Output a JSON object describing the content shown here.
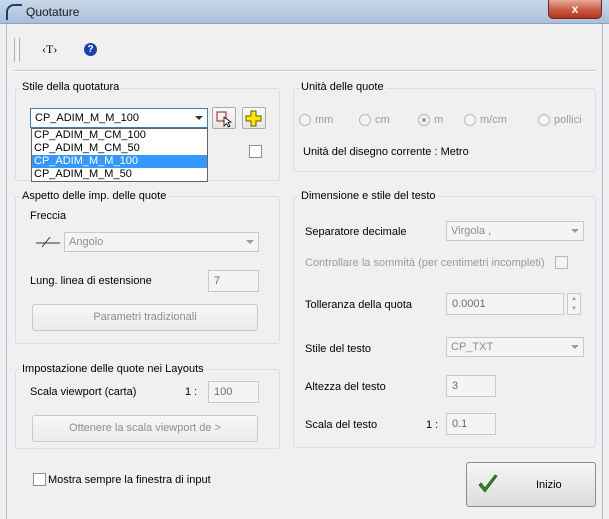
{
  "window": {
    "title": "Quotature",
    "close_label": "x"
  },
  "toolbar": {
    "text_button": "‹T›",
    "help_glyph": "?"
  },
  "stile": {
    "group_title": "Stile della quotatura",
    "selected": "CP_ADIM_M_M_100",
    "options": [
      "CP_ADIM_M_CM_100",
      "CP_ADIM_M_CM_50",
      "CP_ADIM_M_M_100",
      "CP_ADIM_M_M_50"
    ],
    "selected_index": 2
  },
  "unita": {
    "group_title": "Unità delle quote",
    "options": [
      "mm",
      "cm",
      "m",
      "m/cm",
      "pollici"
    ],
    "selected": "m",
    "corrente_label": "Unità del disegno corrente : Metro"
  },
  "aspetto": {
    "group_title": "Aspetto delle imp. delle quote",
    "freccia_label": "Freccia",
    "freccia_value": "Angolo",
    "lung_label": "Lung. linea di estensione",
    "lung_value": "7",
    "parametri_button": "Parametri tradizionali"
  },
  "layouts": {
    "group_title": "Impostazione delle quote nei Layouts",
    "scala_label": "Scala viewport (carta)",
    "scala_prefix": "1 :",
    "scala_value": "100",
    "ottenere_button": "Ottenere la scala viewport de >"
  },
  "dimensione": {
    "group_title": "Dimensione e stile del testo",
    "separatore_label": "Separatore decimale",
    "separatore_value": "Virgola ,",
    "controllare_label": "Controllare la sommità (per centimetri incompleti)",
    "tolleranza_label": "Tolleranza della quota",
    "tolleranza_value": "0.0001",
    "stile_label": "Stile del testo",
    "stile_value": "CP_TXT",
    "altezza_label": "Altezza del testo",
    "altezza_value": "3",
    "scala_label": "Scala del testo",
    "scala_prefix": "1 :",
    "scala_value": "0.1"
  },
  "footer": {
    "mostra_label": "Mostra sempre la finestra di input",
    "inizio_button": "Inizio"
  },
  "colors": {
    "accent": "#3399ff",
    "check_green": "#2e8b1e",
    "close_red": "#c75c42"
  }
}
